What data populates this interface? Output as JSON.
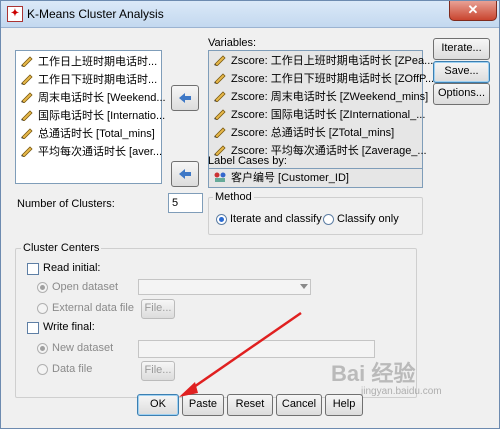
{
  "window": {
    "title": "K-Means Cluster Analysis",
    "close_glyph": "✕"
  },
  "source_list": {
    "items": [
      "工作日上班时期电话时...",
      "工作日下班时期电话时...",
      "周末电话时长 [Weekend...",
      "国际电话时长 [Internatio...",
      "总通话时长 [Total_mins]",
      "平均每次通话时长 [aver..."
    ]
  },
  "variables": {
    "label": "Variables:",
    "items": [
      "Zscore:  工作日上班时期电话时长 [ZPea...",
      "Zscore:  工作日下班时期电话时长 [ZOffP...",
      "Zscore:  周末电话时长 [ZWeekend_mins]",
      "Zscore:  国际电话时长 [ZInternational_...",
      "Zscore:  总通话时长 [ZTotal_mins]",
      "Zscore:  平均每次通话时长 [Zaverage_..."
    ]
  },
  "label_cases": {
    "label": "Label Cases by:",
    "value": "客户编号 [Customer_ID]"
  },
  "clusters": {
    "label": "Number of Clusters:",
    "value": "5"
  },
  "method": {
    "title": "Method",
    "option_iterate": "Iterate and classify",
    "option_classify": "Classify only",
    "selected": "Iterate and classify"
  },
  "side_buttons": {
    "iterate": "Iterate...",
    "save": "Save...",
    "options": "Options..."
  },
  "cluster_centers": {
    "title": "Cluster Centers",
    "read_initial": "Read initial:",
    "open_dataset": "Open dataset",
    "external_file": "External data file",
    "file_button": "File...",
    "write_final": "Write final:",
    "new_dataset": "New dataset",
    "data_file": "Data file"
  },
  "bottom_buttons": {
    "ok": "OK",
    "paste": "Paste",
    "reset": "Reset",
    "cancel": "Cancel",
    "help": "Help"
  },
  "watermark": {
    "text": "Bai 经验",
    "sub": "jingyan.baidu.com"
  },
  "colors": {
    "accent": "#2a6ad1",
    "arrow_button": "#3e78c6",
    "annotation_arrow": "#e02020"
  }
}
